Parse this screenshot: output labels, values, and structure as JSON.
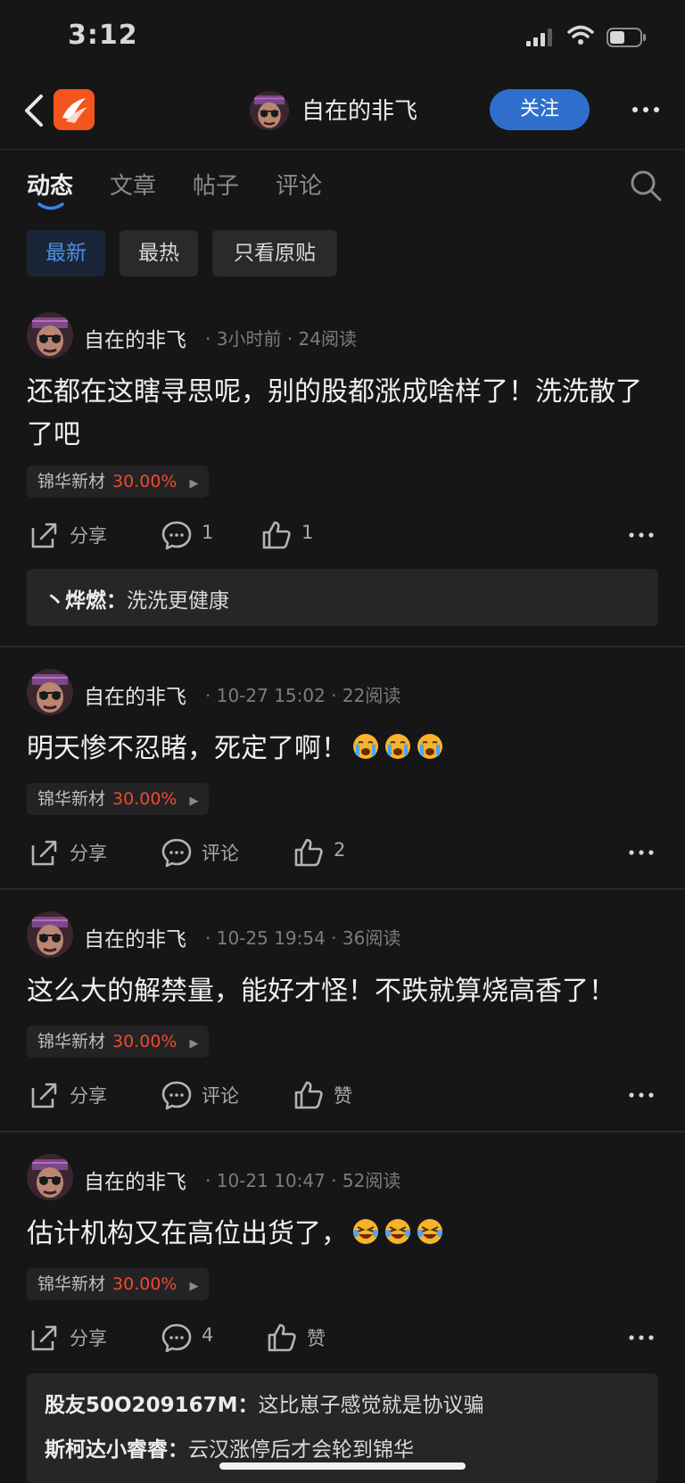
{
  "status_bar": {
    "time": "3:12"
  },
  "nav": {
    "title": "自在的非飞",
    "follow_label": "关注"
  },
  "tabs": [
    {
      "label": "动态",
      "active": true
    },
    {
      "label": "文章",
      "active": false
    },
    {
      "label": "帖子",
      "active": false
    },
    {
      "label": "评论",
      "active": false
    }
  ],
  "filters": [
    {
      "label": "最新",
      "active": true
    },
    {
      "label": "最热",
      "active": false
    },
    {
      "label": "只看原贴",
      "active": false
    }
  ],
  "posts": [
    {
      "author": "自在的非飞",
      "meta": "· 3小时前 · 24阅读",
      "content": "还都在这瞎寻思呢，别的股都涨成啥样了！洗洗散了了吧",
      "stock_name": "锦华新材",
      "stock_change": "30.00%",
      "share_label": "分享",
      "comment_label": "1",
      "like_label": "1",
      "replies": [
        {
          "name": "丶烨燃",
          "text": "洗洗更健康"
        }
      ]
    },
    {
      "author": "自在的非飞",
      "meta": "· 10-27 15:02 · 22阅读",
      "content": "明天惨不忍睹，死定了啊！",
      "emoji": "crying-face",
      "stock_name": "锦华新材",
      "stock_change": "30.00%",
      "share_label": "分享",
      "comment_label": "评论",
      "like_label": "2"
    },
    {
      "author": "自在的非飞",
      "meta": "· 10-25 19:54 · 36阅读",
      "content": "这么大的解禁量，能好才怪！不跌就算烧高香了！",
      "stock_name": "锦华新材",
      "stock_change": "30.00%",
      "share_label": "分享",
      "comment_label": "评论",
      "like_label": "赞"
    },
    {
      "author": "自在的非飞",
      "meta": "· 10-21 10:47 · 52阅读",
      "content": "估计机构又在高位出货了，",
      "emoji": "laughing-tears-face",
      "stock_name": "锦华新材",
      "stock_change": "30.00%",
      "share_label": "分享",
      "comment_label": "4",
      "like_label": "赞",
      "replies": [
        {
          "name": "股友50O209167M",
          "text": "这比崽子感觉就是协议骗"
        },
        {
          "name": "斯柯达小睿睿",
          "text": "云汉涨停后才会轮到锦华"
        }
      ]
    }
  ],
  "colors": {
    "background": "#161617",
    "accent_blue": "#2f6fcb",
    "stock_red": "#ef4a2e",
    "logo_orange": "#f2561d"
  }
}
